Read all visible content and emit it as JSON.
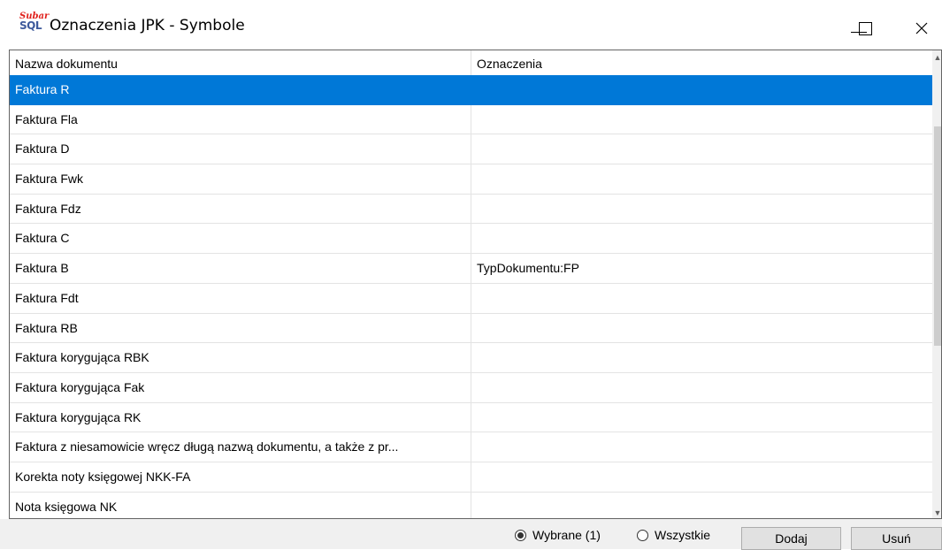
{
  "window": {
    "icon_text_top": "Subar",
    "icon_text_bottom": "SQL",
    "title": "Oznaczenia JPK - Symbole"
  },
  "grid": {
    "columns": [
      "Nazwa dokumentu",
      "Oznaczenia"
    ],
    "selected_row": 0,
    "rows": [
      {
        "name": "Faktura R",
        "mark": ""
      },
      {
        "name": "Faktura Fla",
        "mark": ""
      },
      {
        "name": "Faktura D",
        "mark": ""
      },
      {
        "name": "Faktura Fwk",
        "mark": ""
      },
      {
        "name": "Faktura Fdz",
        "mark": ""
      },
      {
        "name": "Faktura C",
        "mark": ""
      },
      {
        "name": "Faktura B",
        "mark": "TypDokumentu:FP"
      },
      {
        "name": "Faktura Fdt",
        "mark": ""
      },
      {
        "name": "Faktura RB",
        "mark": ""
      },
      {
        "name": "Faktura korygująca RBK",
        "mark": ""
      },
      {
        "name": "Faktura korygująca Fak",
        "mark": ""
      },
      {
        "name": "Faktura korygująca RK",
        "mark": ""
      },
      {
        "name": "Faktura z niesamowicie wręcz długą nazwą dokumentu, a także z pr...",
        "mark": ""
      },
      {
        "name": "Korekta noty księgowej NKK-FA",
        "mark": ""
      },
      {
        "name": "Nota księgowa NK",
        "mark": ""
      }
    ]
  },
  "filter": {
    "selected_label": "Wybrane (1)",
    "all_label": "Wszystkie",
    "active": "selected"
  },
  "buttons": {
    "add": "Dodaj",
    "remove": "Usuń"
  },
  "colors": {
    "selection": "#0078d7",
    "bottom_bar": "#f0f0f0"
  }
}
